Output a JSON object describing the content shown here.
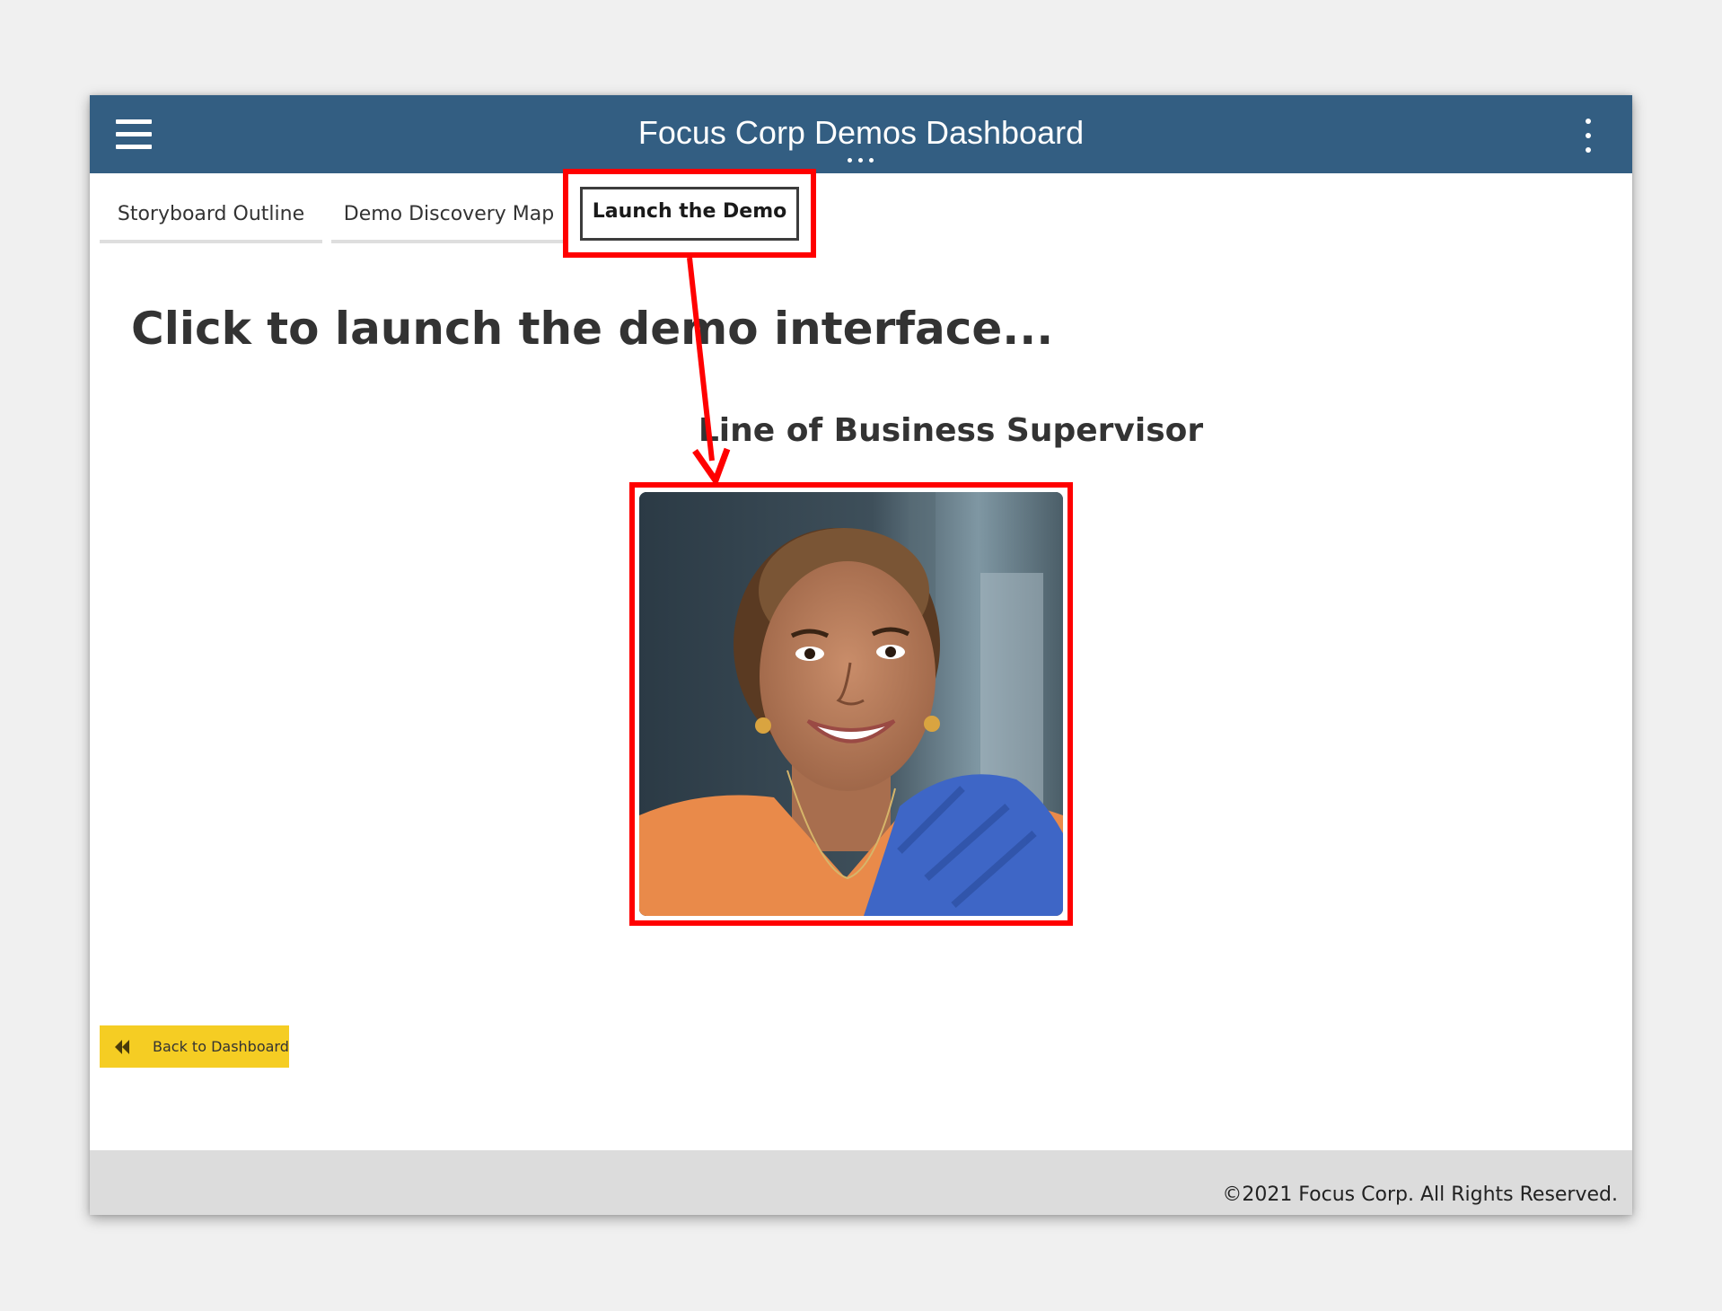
{
  "header": {
    "title": "Focus Corp Demos Dashboard",
    "bg_color": "#335e82",
    "menu_icon": "hamburger-menu-icon",
    "overflow_icon": "more-vertical-icon"
  },
  "tabs": [
    {
      "label": "Storyboard Outline",
      "active": false
    },
    {
      "label": "Demo Discovery Map",
      "active": false
    },
    {
      "label": "Launch the Demo",
      "active": true
    }
  ],
  "main": {
    "heading": "Click to launch the demo interface...",
    "persona": {
      "title": "Line of Business Supervisor",
      "photo": "persona-photo"
    }
  },
  "back_button": {
    "label": "Back to Dashboard",
    "icon": "double-chevron-left-icon",
    "color": "#f5cd23"
  },
  "footer": {
    "copyright": "©2021 Focus Corp. All Rights Reserved."
  },
  "annotation": {
    "highlight_color": "#ff0000"
  }
}
